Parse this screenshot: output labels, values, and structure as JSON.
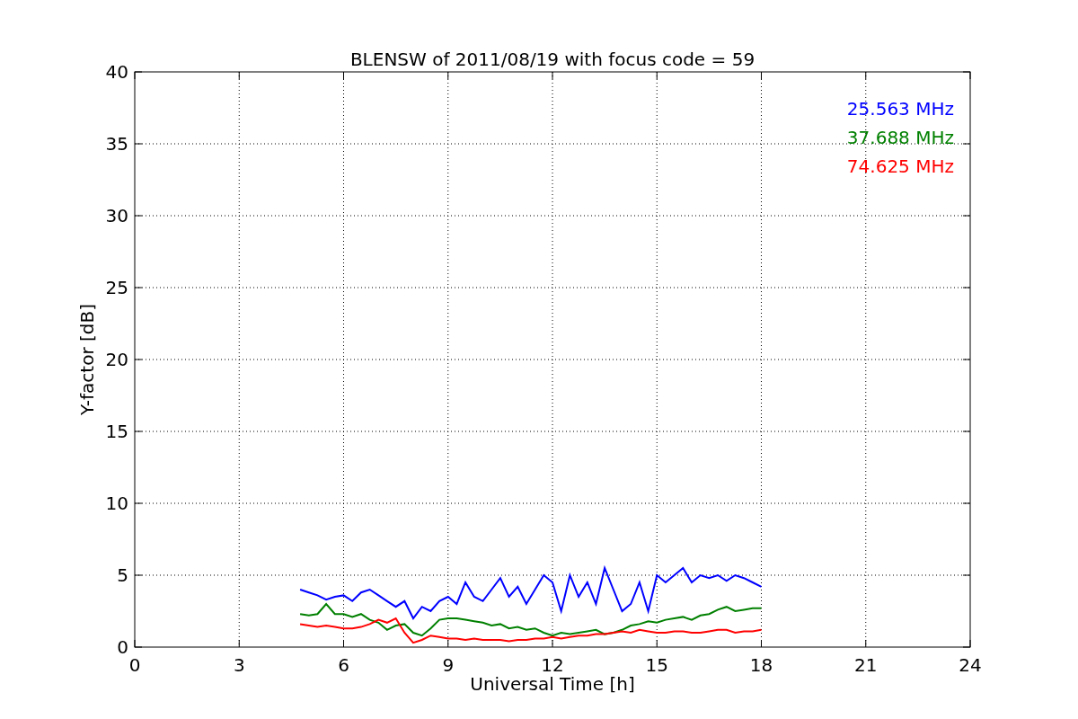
{
  "figure": {
    "chart_data": {
      "type": "line",
      "title": "BLENSW of 2011/08/19 with focus code = 59",
      "xlabel": "Universal Time [h]",
      "ylabel": "Y-factor [dB]",
      "x": [
        4.75,
        5,
        5.25,
        5.5,
        5.75,
        6,
        6.25,
        6.5,
        6.75,
        7,
        7.25,
        7.5,
        7.75,
        8,
        8.25,
        8.5,
        8.75,
        9,
        9.25,
        9.5,
        9.75,
        10,
        10.25,
        10.5,
        10.75,
        11,
        11.25,
        11.5,
        11.75,
        12,
        12.25,
        12.5,
        12.75,
        13,
        13.25,
        13.5,
        13.75,
        14,
        14.25,
        14.5,
        14.75,
        15,
        15.25,
        15.5,
        15.75,
        16,
        16.25,
        16.5,
        16.75,
        17,
        17.25,
        17.5,
        17.75,
        18
      ],
      "series": [
        {
          "name": "25.563 MHz",
          "color": "#0000ff",
          "values": [
            4.0,
            3.8,
            3.6,
            3.3,
            3.5,
            3.6,
            3.2,
            3.8,
            4.0,
            3.6,
            3.2,
            2.8,
            3.2,
            2.0,
            2.8,
            2.5,
            3.2,
            3.5,
            3.0,
            4.5,
            3.5,
            3.2,
            4.0,
            4.8,
            3.5,
            4.2,
            3.0,
            4.0,
            5.0,
            4.5,
            2.5,
            5.0,
            3.5,
            4.5,
            3.0,
            5.5,
            4.0,
            2.5,
            3.0,
            4.5,
            2.5,
            5.0,
            4.5,
            5.0,
            5.5,
            4.5,
            5.0,
            4.8,
            5.0,
            4.6,
            5.0,
            4.8,
            4.5,
            4.2
          ]
        },
        {
          "name": "37.688 MHz",
          "color": "#008000",
          "values": [
            2.3,
            2.2,
            2.3,
            3.0,
            2.3,
            2.3,
            2.1,
            2.3,
            1.9,
            1.7,
            1.2,
            1.5,
            1.6,
            1.0,
            0.8,
            1.3,
            1.9,
            2.0,
            2.0,
            1.9,
            1.8,
            1.7,
            1.5,
            1.6,
            1.3,
            1.4,
            1.2,
            1.3,
            1.0,
            0.8,
            1.0,
            0.9,
            1.0,
            1.1,
            1.2,
            0.9,
            1.0,
            1.2,
            1.5,
            1.6,
            1.8,
            1.7,
            1.9,
            2.0,
            2.1,
            1.9,
            2.2,
            2.3,
            2.6,
            2.8,
            2.5,
            2.6,
            2.7,
            2.7
          ]
        },
        {
          "name": "74.625 MHz",
          "color": "#ff0000",
          "values": [
            1.6,
            1.5,
            1.4,
            1.5,
            1.4,
            1.3,
            1.3,
            1.4,
            1.6,
            1.9,
            1.7,
            2.0,
            1.0,
            0.3,
            0.5,
            0.8,
            0.7,
            0.6,
            0.6,
            0.5,
            0.6,
            0.5,
            0.5,
            0.5,
            0.4,
            0.5,
            0.5,
            0.6,
            0.6,
            0.7,
            0.6,
            0.7,
            0.8,
            0.8,
            0.9,
            0.9,
            1.0,
            1.1,
            1.0,
            1.2,
            1.1,
            1.0,
            1.0,
            1.1,
            1.1,
            1.0,
            1.0,
            1.1,
            1.2,
            1.2,
            1.0,
            1.1,
            1.1,
            1.2
          ]
        }
      ],
      "xlim": [
        0,
        24
      ],
      "ylim": [
        0,
        40
      ],
      "xticks": [
        0,
        3,
        6,
        9,
        12,
        15,
        18,
        21,
        24
      ],
      "yticks": [
        0,
        5,
        10,
        15,
        20,
        25,
        30,
        35,
        40
      ],
      "grid": true
    }
  }
}
